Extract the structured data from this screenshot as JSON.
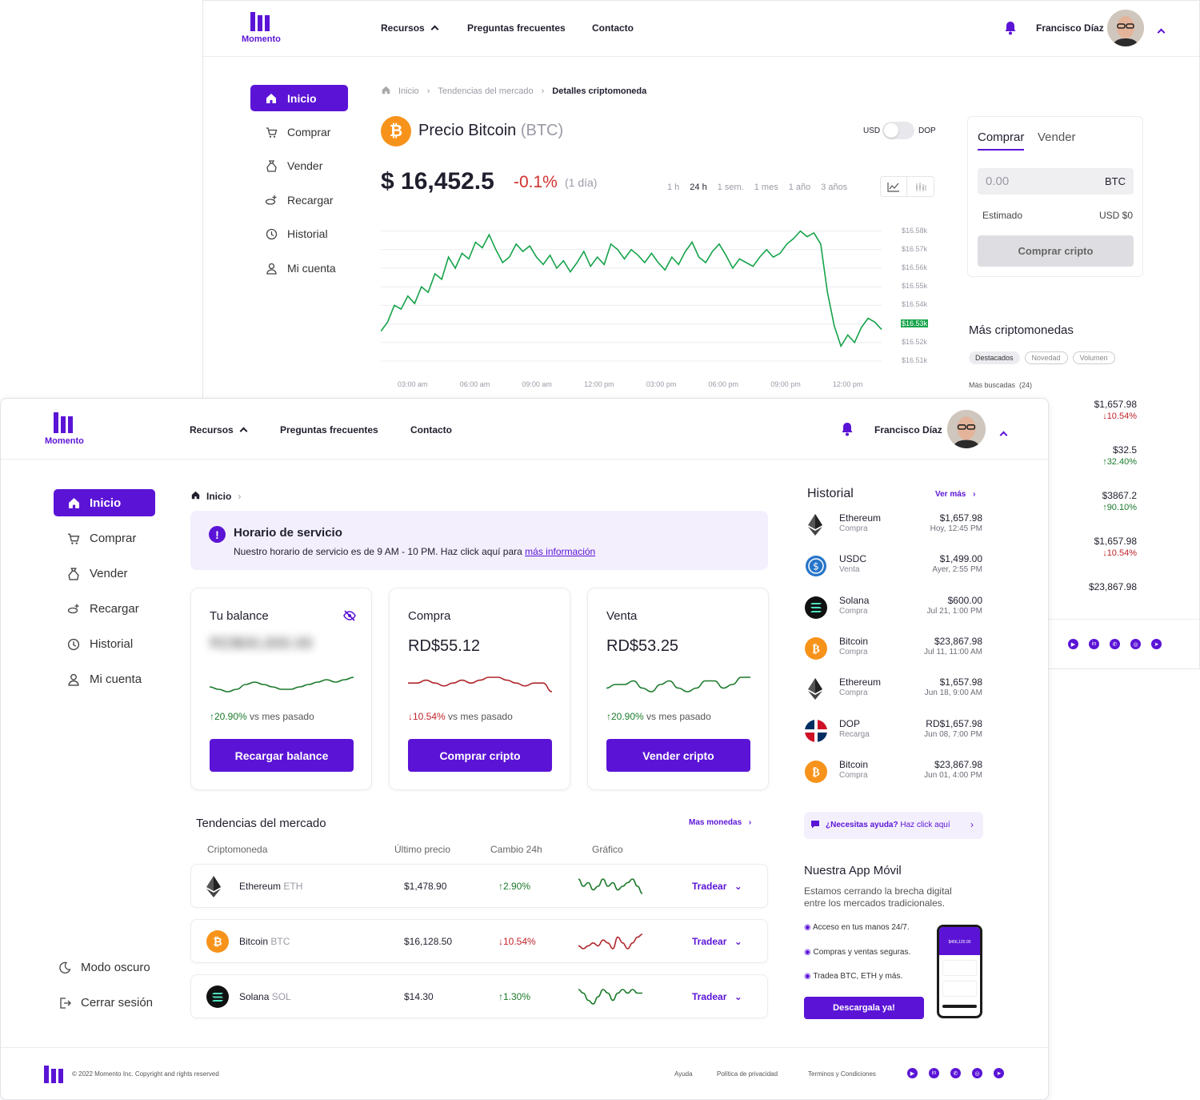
{
  "brand": {
    "name": "Momento",
    "accent": "#5b14d6"
  },
  "header": {
    "nav": [
      "Recursos",
      "Preguntas frecuentes",
      "Contacto"
    ],
    "user_name": "Francisco Díaz"
  },
  "sidebar": {
    "items": [
      "Inicio",
      "Comprar",
      "Vender",
      "Recargar",
      "Historial",
      "Mi cuenta"
    ],
    "dark_mode": "Modo oscuro",
    "logout": "Cerrar sesión"
  },
  "detail": {
    "breadcrumb": [
      "Inicio",
      "Tendencias del mercado",
      "Detalles criptomoneda"
    ],
    "title": "Precio Bitcoin",
    "ticker": "(BTC)",
    "currency_left": "USD",
    "currency_right": "DOP",
    "price": "$ 16,452.5",
    "change": "-0.1%",
    "change_period": "(1 día)",
    "ranges": [
      "1 h",
      "24 h",
      "1 sem.",
      "1 mes",
      "1 año",
      "3 años"
    ],
    "active_range": "24 h",
    "chart_data": {
      "type": "line",
      "title": "",
      "ylabel": "",
      "xlabel": "",
      "ylim": [
        16510,
        16585
      ],
      "y_ticks": [
        "$16.58k",
        "$16.57k",
        "$16.56k",
        "$16.55k",
        "$16.54k",
        "$16.53k",
        "$16.52k",
        "$16.51k"
      ],
      "y_tick_values": [
        16580,
        16570,
        16560,
        16550,
        16540,
        16530,
        16520,
        16510
      ],
      "highlight_tick": "$16.53k",
      "x_ticks": [
        "03:00 am",
        "06:00 am",
        "09:00 am",
        "12:00 pm",
        "03:00 pm",
        "06:00 pm",
        "09:00 pm",
        "12:00 pm"
      ],
      "series": [
        {
          "color": "#16a34a",
          "values": [
            16526,
            16531,
            16540,
            16538,
            16545,
            16541,
            16550,
            16547,
            16557,
            16554,
            16566,
            16560,
            16568,
            16565,
            16574,
            16571,
            16578,
            16570,
            16563,
            16566,
            16573,
            16569,
            16572,
            16566,
            16562,
            16567,
            16560,
            16564,
            16558,
            16563,
            16569,
            16561,
            16566,
            16562,
            16573,
            16570,
            16565,
            16570,
            16567,
            16563,
            16568,
            16563,
            16559,
            16566,
            16562,
            16569,
            16574,
            16566,
            16563,
            16569,
            16573,
            16567,
            16560,
            16565,
            16563,
            16561,
            16566,
            16570,
            16566,
            16568,
            16573,
            16576,
            16580,
            16577,
            16579,
            16573,
            16547,
            16529,
            16518,
            16524,
            16520,
            16528,
            16533,
            16531,
            16527
          ]
        }
      ]
    }
  },
  "trade_panel": {
    "tabs": [
      "Comprar",
      "Vender"
    ],
    "amount_placeholder": "0.00",
    "amount_unit": "BTC",
    "estimated_label": "Estimado",
    "estimated_value": "USD $0",
    "button": "Comprar cripto"
  },
  "more_cryptos": {
    "title": "Más criptomonedas",
    "filters": [
      "Destacados",
      "Novedad",
      "Volumen"
    ],
    "subtitle": "Más buscadas  (24)",
    "items": [
      {
        "price": "$1,657.98",
        "change": "10.54%",
        "dir": "down"
      },
      {
        "price": "$32.5",
        "change": "32.40%",
        "dir": "up"
      },
      {
        "price": "$3867.2",
        "change": "90.10%",
        "dir": "up"
      },
      {
        "price": "$1,657.98",
        "change": "10.54%",
        "dir": "down"
      },
      {
        "price": "$23,867.98",
        "change": "",
        "dir": ""
      }
    ]
  },
  "dashboard": {
    "breadcrumb": "Inicio",
    "notice": {
      "title": "Horario de servicio",
      "text": "Nuestro horario de servicio es de 9 AM - 10 PM. Haz click aquí para ",
      "link": "más información"
    },
    "cards": [
      {
        "title": "Tu balance",
        "value": "RD$00,000.00",
        "change": "20.90%",
        "dir": "up",
        "suffix": "vs mes pasado",
        "button": "Recargar balance",
        "spark": [
          5,
          6,
          7,
          6,
          4,
          3,
          4,
          5,
          6,
          6,
          5,
          4,
          3,
          2,
          3,
          2,
          1
        ],
        "color": "#1b7a2b"
      },
      {
        "title": "Compra",
        "value": "RD$55.12",
        "change": "10.54%",
        "dir": "down",
        "suffix": "vs mes pasado",
        "button": "Comprar cripto",
        "spark": [
          3,
          3,
          2,
          3,
          4,
          3,
          2,
          3,
          2,
          1,
          1,
          2,
          3,
          4,
          3,
          3,
          6
        ],
        "color": "#b0282e"
      },
      {
        "title": "Venta",
        "value": "RD$53.25",
        "change": "20.90%",
        "dir": "up",
        "suffix": "vs mes pasado",
        "button": "Vender cripto",
        "spark": [
          4,
          3,
          3,
          2,
          4,
          5,
          3,
          2,
          4,
          5,
          4,
          2,
          2,
          4,
          3,
          1,
          1
        ],
        "color": "#1b7a2b"
      }
    ],
    "market": {
      "title": "Tendencias del mercado",
      "more": "Mas monedas",
      "headers": [
        "Criptomoneda",
        "Último precio",
        "Cambio 24h",
        "Gráfico"
      ],
      "rows": [
        {
          "name": "Ethereum",
          "ticker": "ETH",
          "price": "$1,478.90",
          "change": "2.90%",
          "dir": "up",
          "action": "Tradear",
          "spark": [
            2,
            4,
            3,
            5,
            4,
            2,
            4,
            3,
            5,
            4,
            3,
            2,
            4,
            6
          ],
          "color": "#1b7a2b"
        },
        {
          "name": "Bitcoin",
          "ticker": "BTC",
          "price": "$16,128.50",
          "change": "10.54%",
          "dir": "down",
          "action": "Tradear",
          "spark": [
            5,
            6,
            5,
            4,
            5,
            3,
            4,
            6,
            2,
            4,
            6,
            4,
            2,
            1
          ],
          "color": "#b0282e"
        },
        {
          "name": "Solana",
          "ticker": "SOL",
          "price": "$14.30",
          "change": "1.30%",
          "dir": "up",
          "action": "Tradear",
          "spark": [
            2,
            3,
            5,
            6,
            4,
            2,
            3,
            5,
            3,
            2,
            3,
            2,
            3,
            3
          ],
          "color": "#1b7a2b"
        }
      ]
    }
  },
  "history": {
    "title": "Historial",
    "more": "Ver más",
    "items": [
      {
        "name": "Ethereum",
        "type": "Compra",
        "amount": "$1,657.98",
        "date": "Hoy, 12:45 PM",
        "icon": "ethereum"
      },
      {
        "name": "USDC",
        "type": "Venta",
        "amount": "$1,499.00",
        "date": "Ayer, 2:55 PM",
        "icon": "usdc"
      },
      {
        "name": "Solana",
        "type": "Compra",
        "amount": "$600.00",
        "date": "Jul 21, 1:00 PM",
        "icon": "solana"
      },
      {
        "name": "Bitcoin",
        "type": "Compra",
        "amount": "$23,867.98",
        "date": "Jul 11, 11:00 AM",
        "icon": "bitcoin"
      },
      {
        "name": "Ethereum",
        "type": "Compra",
        "amount": "$1,657.98",
        "date": "Jun 18, 9:00 AM",
        "icon": "ethereum"
      },
      {
        "name": "DOP",
        "type": "Recarga",
        "amount": "RD$1,657.98",
        "date": "Jun 08, 7:00 PM",
        "icon": "dop-flag"
      },
      {
        "name": "Bitcoin",
        "type": "Compra",
        "amount": "$23,867.98",
        "date": "Jun 01, 4:00 PM",
        "icon": "bitcoin"
      }
    ]
  },
  "help": {
    "lead": "¿Necesitas ayuda?",
    "text": " Haz click aquí"
  },
  "app": {
    "title": "Nuestra App Móvil",
    "desc": "Estamos cerrando la brecha digital entre los mercados tradicionales.",
    "features": [
      "Acceso en tus manos 24/7.",
      "Compras y ventas seguras.",
      "Tradea BTC, ETH y más."
    ],
    "button": "Descargala ya!",
    "phone_balance": "$456,120.00"
  },
  "footer": {
    "copyright": "© 2022 Momento Inc. Copyright and rights reserved",
    "links": [
      "Ayuda",
      "Política de privacidad",
      "Terminos y Condiciones"
    ]
  },
  "colors": {
    "up": "#1b7a2b",
    "down": "#c0232b",
    "chart_line": "#16a34a",
    "bitcoin": "#f7931a"
  }
}
